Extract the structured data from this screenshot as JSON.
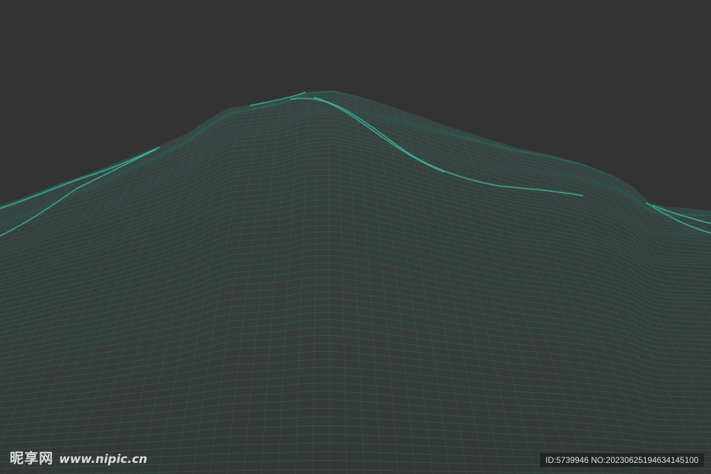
{
  "scene": {
    "subject": "wireframe mountain terrain",
    "background_color": "#333333",
    "surface_fill": "#363b39",
    "mesh_color": "#2a6b60",
    "highlight_color": "#3fd6be"
  },
  "watermark": {
    "brand": "昵享网",
    "url": "www.nipic.cn",
    "id_text": "ID:5739946 NO:20230625194634145100"
  }
}
